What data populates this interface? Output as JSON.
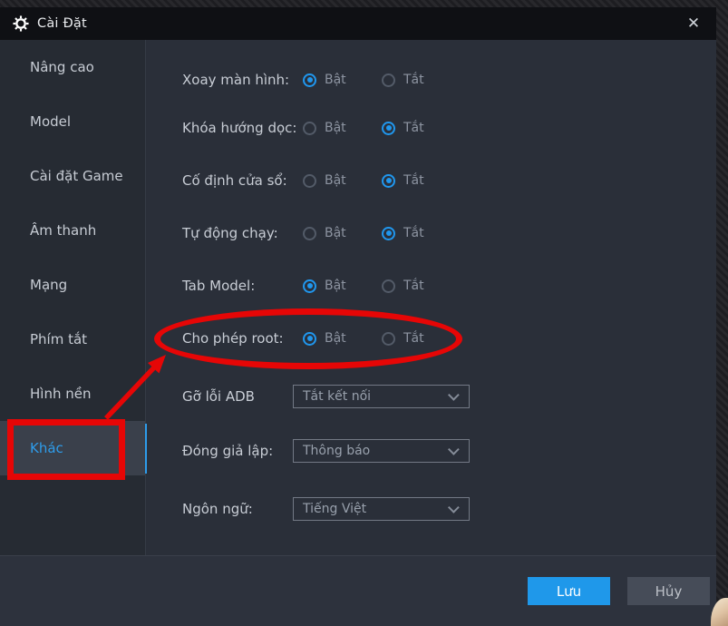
{
  "titlebar": {
    "title": "Cài Đặt",
    "close_glyph": "✕"
  },
  "sidebar": {
    "items": [
      {
        "label": "Nâng cao",
        "active": false
      },
      {
        "label": "Model",
        "active": false
      },
      {
        "label": "Cài đặt Game",
        "active": false
      },
      {
        "label": "Âm thanh",
        "active": false
      },
      {
        "label": "Mạng",
        "active": false
      },
      {
        "label": "Phím tắt",
        "active": false
      },
      {
        "label": "Hình nền",
        "active": false
      },
      {
        "label": "Khác",
        "active": true
      }
    ]
  },
  "settings": {
    "radio_rows": [
      {
        "label": "Xoay màn hình:",
        "on_label": "Bật",
        "off_label": "Tắt",
        "value": "on"
      },
      {
        "label": "Khóa hướng dọc:",
        "on_label": "Bật",
        "off_label": "Tắt",
        "value": "off"
      },
      {
        "label": "Cố định cửa sổ:",
        "on_label": "Bật",
        "off_label": "Tắt",
        "value": "off"
      },
      {
        "label": "Tự động chạy:",
        "on_label": "Bật",
        "off_label": "Tắt",
        "value": "off"
      },
      {
        "label": "Tab Model:",
        "on_label": "Bật",
        "off_label": "Tắt",
        "value": "on"
      },
      {
        "label": "Cho phép root:",
        "on_label": "Bật",
        "off_label": "Tắt",
        "value": "on"
      }
    ],
    "dropdown_rows": [
      {
        "label": "Gỡ lỗi ADB",
        "value": "Tắt kết nối"
      },
      {
        "label": "Đóng giả lập:",
        "value": "Thông báo"
      },
      {
        "label": "Ngôn ngữ:",
        "value": "Tiếng Việt"
      }
    ]
  },
  "footer": {
    "save_label": "Lưu",
    "cancel_label": "Hủy"
  },
  "annotations": {
    "highlight_color": "#e60606",
    "circled_setting": "Cho phép root:",
    "boxed_sidebar_item": "Khác"
  },
  "colors": {
    "accent_blue": "#2097ee",
    "dialog_bg": "#2a2f39",
    "titlebar_bg": "#0f1014"
  }
}
